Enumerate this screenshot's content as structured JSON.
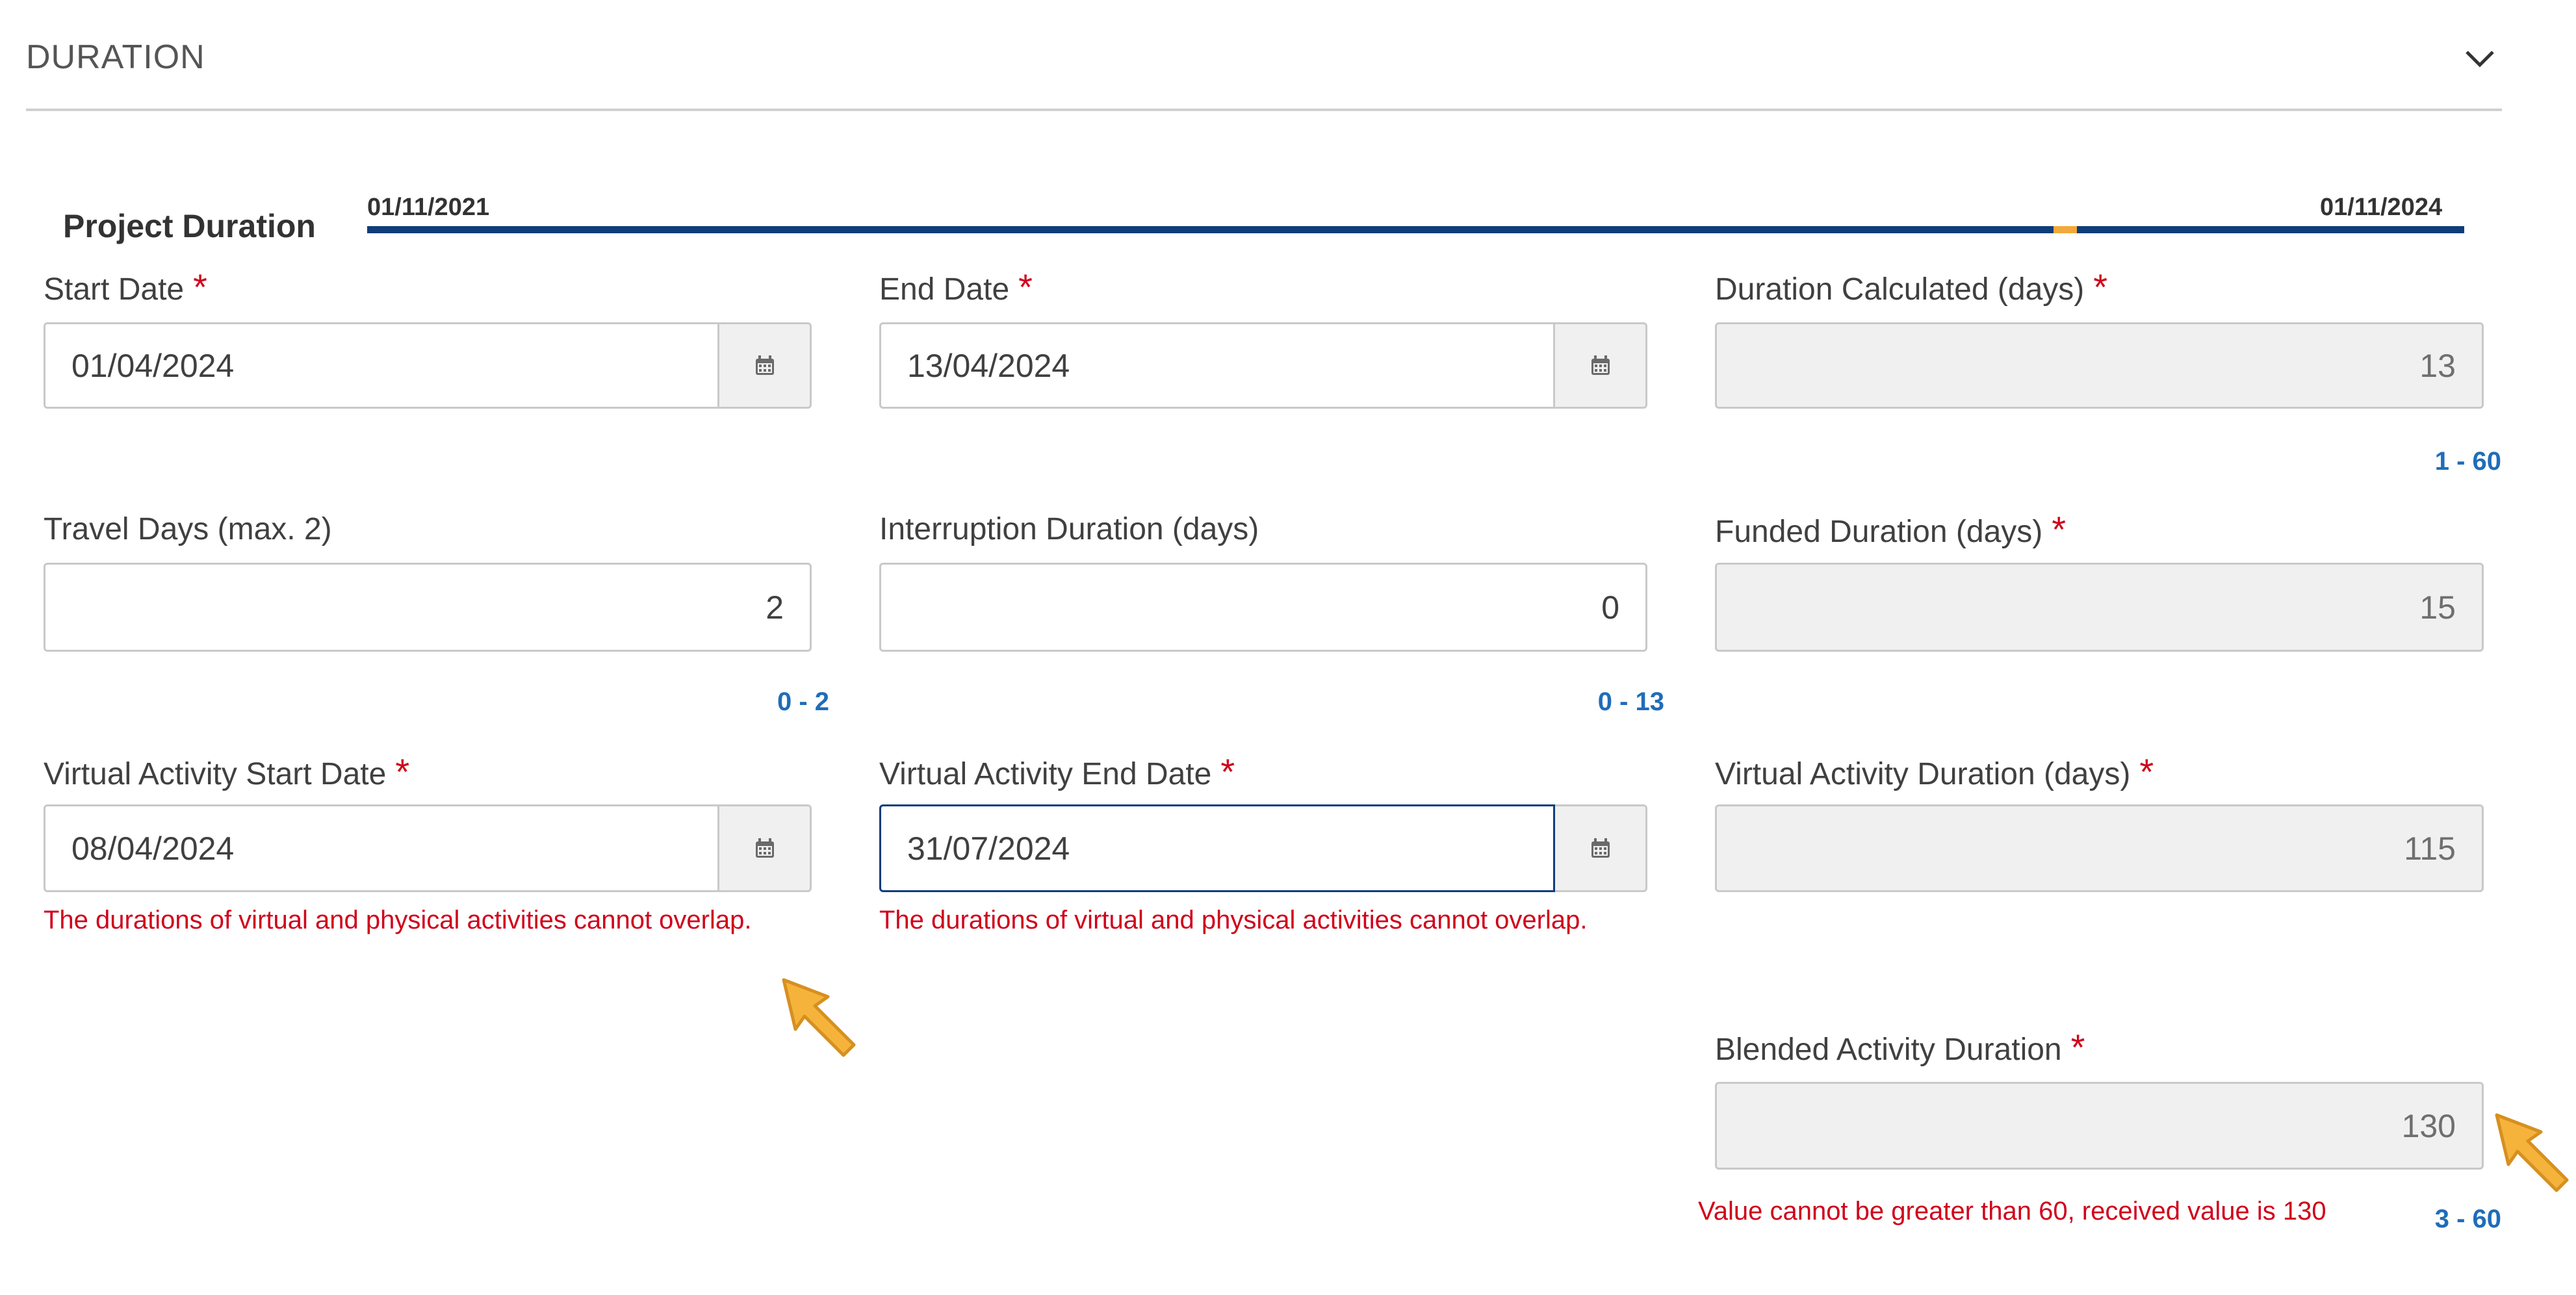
{
  "section": {
    "title": "DURATION"
  },
  "project_duration": {
    "label": "Project Duration",
    "start": "01/11/2021",
    "end": "01/11/2024"
  },
  "fields": {
    "start_date": {
      "label": "Start Date",
      "required_mark": "*",
      "value": "01/04/2024"
    },
    "end_date": {
      "label": "End Date",
      "required_mark": "*",
      "value": "13/04/2024"
    },
    "duration_calculated": {
      "label": "Duration Calculated (days)",
      "required_mark": "*",
      "value": "13",
      "range": "1 - 60"
    },
    "travel_days": {
      "label": "Travel Days (max. 2)",
      "value": "2",
      "range": "0 - 2"
    },
    "interruption_duration": {
      "label": "Interruption Duration (days)",
      "value": "0",
      "range": "0 - 13"
    },
    "funded_duration": {
      "label": "Funded Duration (days)",
      "required_mark": "*",
      "value": "15"
    },
    "virtual_start": {
      "label": "Virtual Activity Start Date",
      "required_mark": "*",
      "value": "08/04/2024",
      "error": "The durations of virtual and physical activities cannot overlap."
    },
    "virtual_end": {
      "label": "Virtual Activity End Date",
      "required_mark": "*",
      "value": "31/07/2024",
      "error": "The durations of virtual and physical activities cannot overlap."
    },
    "virtual_duration": {
      "label": "Virtual Activity Duration (days)",
      "required_mark": "*",
      "value": "115"
    },
    "blended_duration": {
      "label": "Blended Activity Duration",
      "required_mark": "*",
      "value": "130",
      "range": "3 - 60",
      "error": "Value cannot be greater than 60, received value is 130"
    }
  },
  "icons": {
    "calendar": "calendar-icon",
    "chevron": "chevron-down-icon",
    "cursor": "pointer-cursor-icon"
  },
  "colors": {
    "required": "#d0021b",
    "error": "#d0021b",
    "range": "#1f6db8",
    "timeline": "#0f3d7a",
    "timeline_marker": "#f2a93b",
    "cursor": "#f5b33c"
  }
}
